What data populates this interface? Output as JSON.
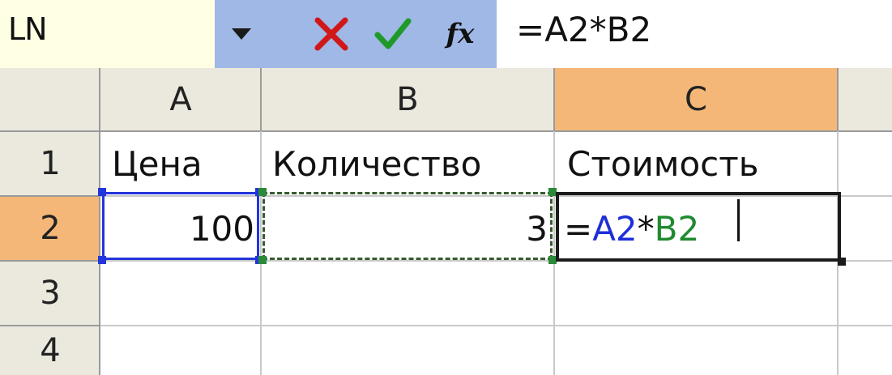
{
  "name_box": {
    "value": "LN"
  },
  "formula_bar": {
    "cancel_icon": "close-x-icon",
    "enter_icon": "checkmark-icon",
    "fx_label": "fx",
    "formula": "=A2*B2"
  },
  "columns": [
    "A",
    "B",
    "C"
  ],
  "rows": [
    "1",
    "2",
    "3",
    "4"
  ],
  "cells": {
    "A1": "Цена",
    "B1": "Количество",
    "C1": "Стоимость",
    "A2": "100",
    "B2": "3",
    "C2": {
      "eq": "=",
      "ref1": "A2",
      "op": "*",
      "ref2": "B2"
    }
  },
  "colors": {
    "ref_a": "#1d2fd8",
    "ref_b": "#1f8a2f",
    "selected_header": "#f4b778",
    "header": "#ebe9de",
    "button_zone": "#9fb8e6"
  }
}
